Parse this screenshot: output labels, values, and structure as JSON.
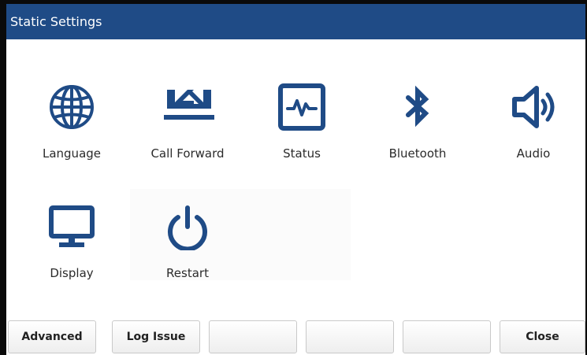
{
  "window": {
    "title": "Static Settings"
  },
  "accent_color": "#1f4b86",
  "tiles": [
    {
      "label": "Language",
      "icon": "globe-icon"
    },
    {
      "label": "Call Forward",
      "icon": "call-forward-icon"
    },
    {
      "label": "Status",
      "icon": "status-icon"
    },
    {
      "label": "Bluetooth",
      "icon": "bluetooth-icon"
    },
    {
      "label": "Audio",
      "icon": "speaker-icon"
    },
    {
      "label": "Display",
      "icon": "monitor-icon"
    },
    {
      "label": "Restart",
      "icon": "power-icon"
    }
  ],
  "softkeys": [
    {
      "label": "Advanced"
    },
    {
      "label": "Log Issue"
    },
    {
      "label": ""
    },
    {
      "label": ""
    },
    {
      "label": ""
    },
    {
      "label": "Close"
    }
  ]
}
